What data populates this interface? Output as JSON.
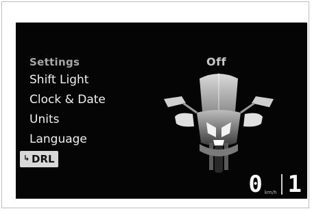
{
  "menu": {
    "header": "Settings",
    "items": [
      {
        "label": "Shift Light"
      },
      {
        "label": "Clock & Date"
      },
      {
        "label": "Units"
      },
      {
        "label": "Language"
      }
    ],
    "selected": {
      "label": "DRL",
      "icon": "chevron-right-icon"
    }
  },
  "status": {
    "value": "Off"
  },
  "speed": {
    "value": "0",
    "unit": "km/h"
  },
  "gear": {
    "value": "1"
  },
  "colors": {
    "screen_bg": "#050505",
    "selected_bg": "#d8d8d8",
    "header_text": "#a8a8a8",
    "item_text": "#f0f0f0"
  }
}
